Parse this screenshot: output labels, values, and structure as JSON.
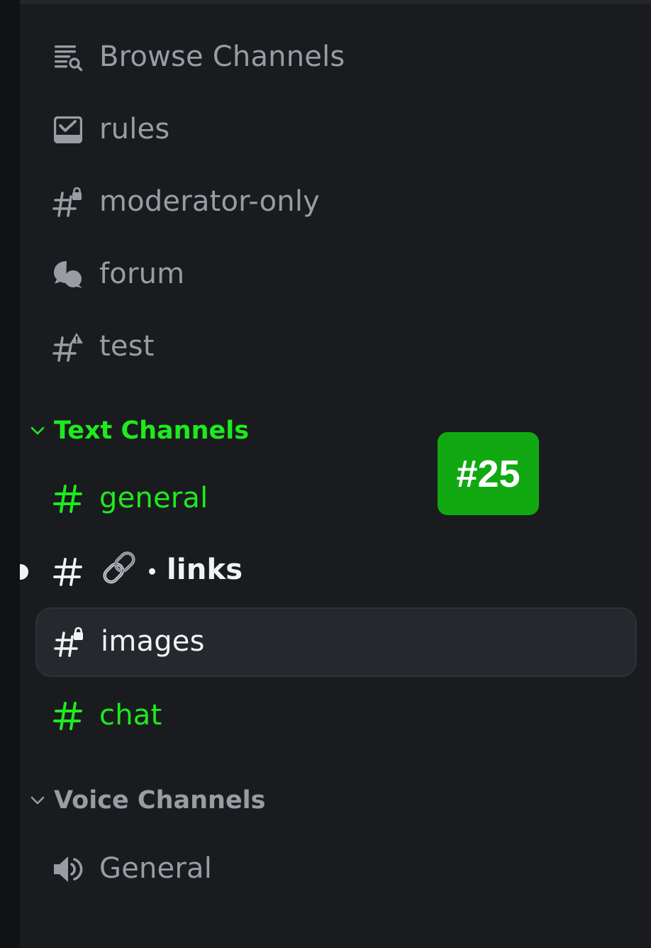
{
  "channels_top": [
    {
      "label": "Browse Channels",
      "icon": "browse-channels-icon"
    },
    {
      "label": "rules",
      "icon": "rules-icon"
    },
    {
      "label": "moderator-only",
      "icon": "hashtag-lock-icon"
    },
    {
      "label": "forum",
      "icon": "forum-icon"
    },
    {
      "label": "test",
      "icon": "hashtag-warning-icon"
    }
  ],
  "text_category": {
    "label": "Text Channels",
    "color": "#1eea1e"
  },
  "text_channels": [
    {
      "label": "general",
      "icon": "hashtag-icon",
      "state": "active"
    },
    {
      "label": "links",
      "prefix_emoji": "link-emoji",
      "icon": "hashtag-icon",
      "state": "unread"
    },
    {
      "label": "images",
      "icon": "hashtag-lock-icon",
      "state": "selected"
    },
    {
      "label": "chat",
      "icon": "hashtag-icon",
      "state": "active"
    }
  ],
  "voice_category": {
    "label": "Voice Channels"
  },
  "voice_channels": [
    {
      "label": "General",
      "icon": "speaker-icon"
    }
  ],
  "badge": {
    "text": "#25",
    "color": "#11a812"
  },
  "colors": {
    "background": "#1a1b1e",
    "muted_text": "#9a9ca4",
    "highlight_green": "#1eea1e",
    "white_text": "#f2f3f5",
    "selected_row": "#27282e"
  }
}
